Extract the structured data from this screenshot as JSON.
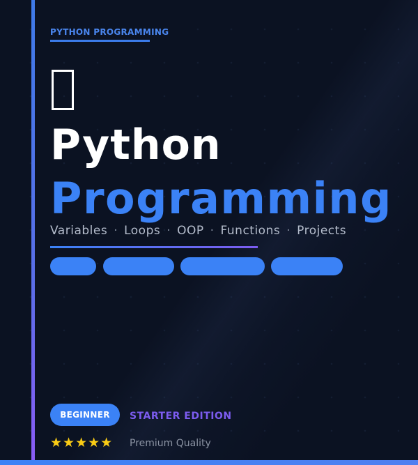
{
  "cover": {
    "eyebrow": "PYTHON PROGRAMMING",
    "icon": "missing-glyph-box-icon",
    "title_line1": "Python",
    "title_line2": "Programming",
    "topics": [
      "Variables",
      "Loops",
      "OOP",
      "Functions",
      "Projects"
    ],
    "topic_separator": "·",
    "badge": "BEGINNER",
    "edition": "STARTER EDITION",
    "stars": "★★★★★",
    "rating_count": 5,
    "quality": "Premium Quality"
  },
  "colors": {
    "background": "#0b1222",
    "accent_blue": "#3b82f6",
    "accent_purple": "#7c5cf0",
    "star": "#facc15"
  }
}
